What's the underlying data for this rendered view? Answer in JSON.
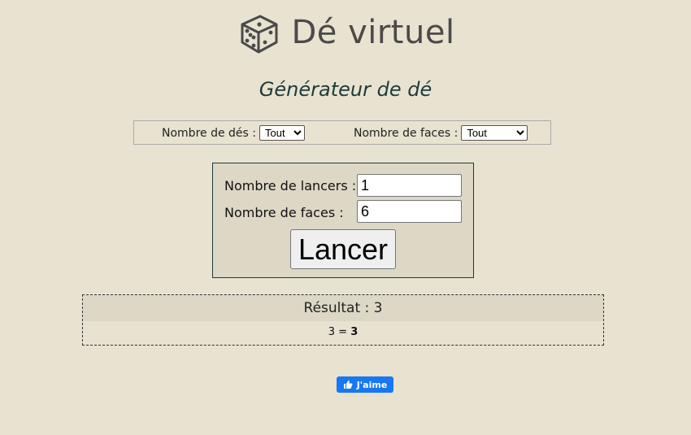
{
  "header": {
    "title": "Dé virtuel",
    "icon": "dice-icon",
    "icon_color": "#4a4a4a"
  },
  "subtitle": "Générateur de dé",
  "filters": {
    "dice_count_label": "Nombre de dés :",
    "dice_count_value": "Tout",
    "faces_label": "Nombre de faces :",
    "faces_value": "Tout"
  },
  "form": {
    "throws_label": "Nombre de lancers :",
    "throws_value": "1",
    "faces_label": "Nombre de faces :",
    "faces_value": "6",
    "launch_label": "Lancer"
  },
  "result": {
    "title": "Résultat : 3",
    "expression": "3 = ",
    "total": "3"
  },
  "like": {
    "label": "J'aime",
    "icon": "thumbs-up-icon",
    "color": "#1877f2"
  },
  "colors": {
    "background": "#e8e2d0",
    "panel": "#dcd8c5",
    "subtitle": "#1e3b3b"
  }
}
